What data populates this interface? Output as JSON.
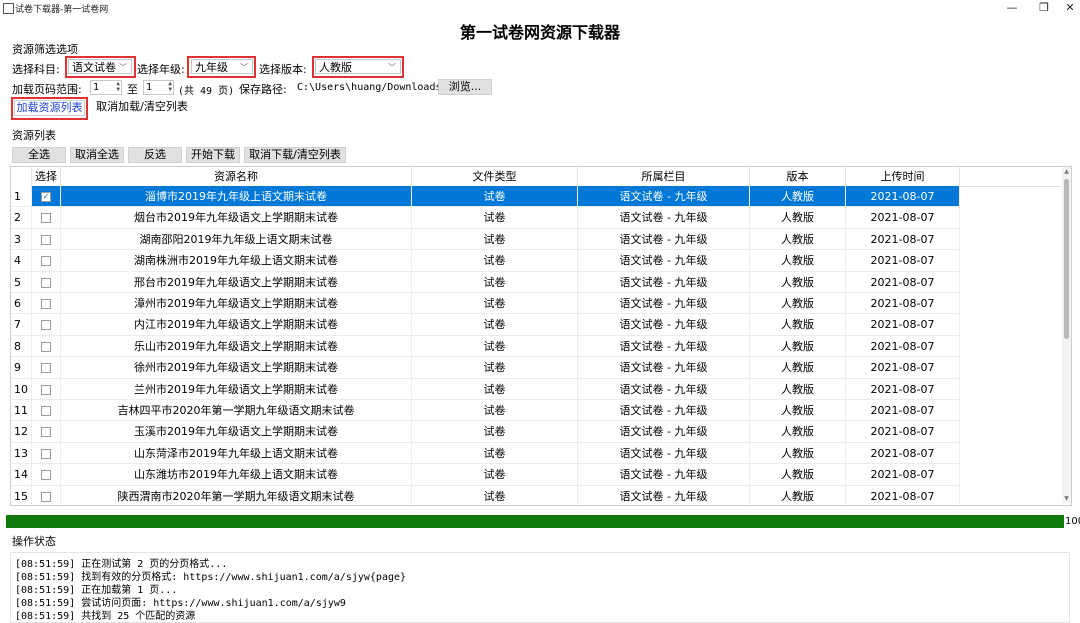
{
  "window": {
    "title": "试卷下载器-第一试卷网",
    "minimize": "—",
    "restore": "❐",
    "close": "✕"
  },
  "main_title": "第一试卷网资源下载器",
  "filter": {
    "section_label": "资源筛选选项",
    "subject_label": "选择科目:",
    "subject_value": "语文试卷",
    "grade_label": "选择年级:",
    "grade_value": "九年级",
    "edition_label": "选择版本:",
    "edition_value": "人教版",
    "page_range_label": "加载页码范围:",
    "page_from": "1",
    "to_label": "至",
    "page_to": "1",
    "total_pages": "(共 49 页)",
    "save_path_label": "保存路径:",
    "save_path": "C:\\Users\\huang/Downloads",
    "browse_label": "浏览...",
    "load_button": "加载资源列表",
    "cancel_load_button": "取消加载/清空列表"
  },
  "list": {
    "section_label": "资源列表",
    "select_all": "全选",
    "deselect_all": "取消全选",
    "invert": "反选",
    "start_download": "开始下载",
    "cancel_download": "取消下载/清空列表",
    "columns": [
      "选择",
      "资源名称",
      "文件类型",
      "所属栏目",
      "版本",
      "上传时间"
    ],
    "rows": [
      {
        "num": "1",
        "checked": true,
        "name": "淄博市2019年九年级上语文期末试卷",
        "type": "试卷",
        "column": "语文试卷 - 九年级",
        "edition": "人教版",
        "date": "2021-08-07"
      },
      {
        "num": "2",
        "checked": false,
        "name": "烟台市2019年九年级语文上学期期末试卷",
        "type": "试卷",
        "column": "语文试卷 - 九年级",
        "edition": "人教版",
        "date": "2021-08-07"
      },
      {
        "num": "3",
        "checked": false,
        "name": "湖南邵阳2019年九年级上语文期末试卷",
        "type": "试卷",
        "column": "语文试卷 - 九年级",
        "edition": "人教版",
        "date": "2021-08-07"
      },
      {
        "num": "4",
        "checked": false,
        "name": "湖南株洲市2019年九年级上语文期末试卷",
        "type": "试卷",
        "column": "语文试卷 - 九年级",
        "edition": "人教版",
        "date": "2021-08-07"
      },
      {
        "num": "5",
        "checked": false,
        "name": "邢台市2019年九年级语文上学期期末试卷",
        "type": "试卷",
        "column": "语文试卷 - 九年级",
        "edition": "人教版",
        "date": "2021-08-07"
      },
      {
        "num": "6",
        "checked": false,
        "name": "漳州市2019年九年级语文上学期期末试卷",
        "type": "试卷",
        "column": "语文试卷 - 九年级",
        "edition": "人教版",
        "date": "2021-08-07"
      },
      {
        "num": "7",
        "checked": false,
        "name": "内江市2019年九年级语文上学期期末试卷",
        "type": "试卷",
        "column": "语文试卷 - 九年级",
        "edition": "人教版",
        "date": "2021-08-07"
      },
      {
        "num": "8",
        "checked": false,
        "name": "乐山市2019年九年级语文上学期期末试卷",
        "type": "试卷",
        "column": "语文试卷 - 九年级",
        "edition": "人教版",
        "date": "2021-08-07"
      },
      {
        "num": "9",
        "checked": false,
        "name": "徐州市2019年九年级语文上学期期末试卷",
        "type": "试卷",
        "column": "语文试卷 - 九年级",
        "edition": "人教版",
        "date": "2021-08-07"
      },
      {
        "num": "10",
        "checked": false,
        "name": "兰州市2019年九年级语文上学期期末试卷",
        "type": "试卷",
        "column": "语文试卷 - 九年级",
        "edition": "人教版",
        "date": "2021-08-07"
      },
      {
        "num": "11",
        "checked": false,
        "name": "吉林四平市2020年第一学期九年级语文期末试卷",
        "type": "试卷",
        "column": "语文试卷 - 九年级",
        "edition": "人教版",
        "date": "2021-08-07"
      },
      {
        "num": "12",
        "checked": false,
        "name": "玉溪市2019年九年级语文上学期期末试卷",
        "type": "试卷",
        "column": "语文试卷 - 九年级",
        "edition": "人教版",
        "date": "2021-08-07"
      },
      {
        "num": "13",
        "checked": false,
        "name": "山东菏泽市2019年九年级上语文期末试卷",
        "type": "试卷",
        "column": "语文试卷 - 九年级",
        "edition": "人教版",
        "date": "2021-08-07"
      },
      {
        "num": "14",
        "checked": false,
        "name": "山东潍坊市2019年九年级上语文期末试卷",
        "type": "试卷",
        "column": "语文试卷 - 九年级",
        "edition": "人教版",
        "date": "2021-08-07"
      },
      {
        "num": "15",
        "checked": false,
        "name": "陕西渭南市2020年第一学期九年级语文期末试卷",
        "type": "试卷",
        "column": "语文试卷 - 九年级",
        "edition": "人教版",
        "date": "2021-08-07"
      }
    ]
  },
  "progress": {
    "value": 100,
    "label": "100"
  },
  "status": {
    "section_label": "操作状态",
    "lines": [
      "[08:51:59] 正在测试第 2 页的分页格式...",
      "[08:51:59] 找到有效的分页格式: https://www.shijuan1.com/a/sjyw{page}",
      "[08:51:59] 正在加载第 1 页...",
      "[08:51:59] 尝试访问页面: https://www.shijuan1.com/a/sjyw9",
      "[08:51:59] 共找到 25 个匹配的资源"
    ]
  },
  "colors": {
    "selection": "#0078d7",
    "progress": "#0f7b0f",
    "highlight_box": "#e03232"
  }
}
